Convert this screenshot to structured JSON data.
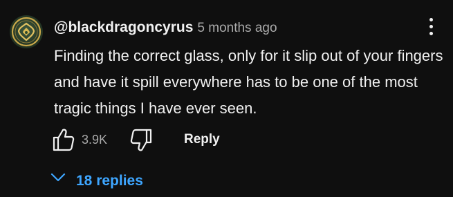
{
  "comment": {
    "author": "@blackdragoncyrus",
    "timestamp": "5 months ago",
    "text": "Finding the correct glass, only for it slip out of your fingers and have it spill everywhere has to be one of the most tragic things I have ever seen.",
    "avatar_icon": "green-gold-emblem-avatar",
    "likes": "3.9K",
    "reply_label": "Reply",
    "replies_label": "18 replies",
    "menu_icon": "vertical-dots-icon",
    "like_icon": "thumbs-up-icon",
    "dislike_icon": "thumbs-down-icon",
    "replies_icon": "chevron-down-icon"
  },
  "colors": {
    "background": "#0f0f0f",
    "text_primary": "#f1f1f1",
    "text_secondary": "#aaaaaa",
    "link_blue": "#3ea6ff"
  }
}
